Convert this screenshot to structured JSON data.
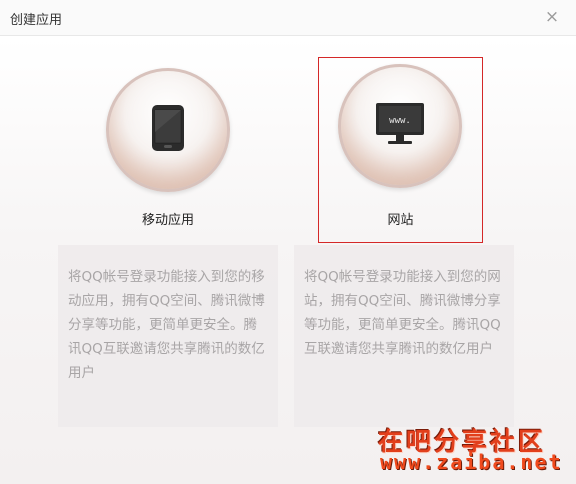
{
  "dialog": {
    "title": "创建应用",
    "close_symbol": "×"
  },
  "options": {
    "mobile": {
      "label": "移动应用",
      "icon": "mobile-phone-icon",
      "description": "将QQ帐号登录功能接入到您的移动应用，拥有QQ空间、腾讯微博分享等功能，更简单更安全。腾讯QQ互联邀请您共享腾讯的数亿用户"
    },
    "web": {
      "label": "网站",
      "icon": "monitor-icon",
      "screen_text": "www.",
      "description": "将QQ帐号登录功能接入到您的网站，拥有QQ空间、腾讯微博分享等功能，更简单更安全。腾讯QQ互联邀请您共享腾讯的数亿用户",
      "selected": true
    }
  },
  "watermark": {
    "line1": "在吧分享社区",
    "line2": "www.zaiba.net"
  },
  "colors": {
    "selection_border": "#d42828",
    "desc_text": "#a8a5a6",
    "watermark": "#e23f1c"
  }
}
